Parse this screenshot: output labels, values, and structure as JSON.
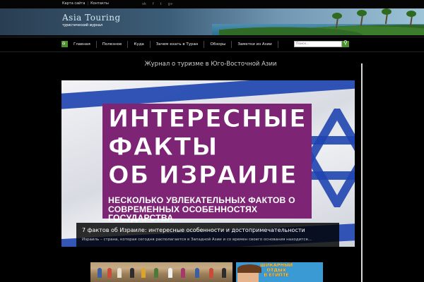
{
  "topbar": {
    "links": [
      "Карта сайта",
      "Контакты"
    ],
    "social": [
      "vk-icon",
      "facebook-icon",
      "twitter-icon",
      "google-plus-icon"
    ]
  },
  "header": {
    "logo_title": "Asia Touring",
    "logo_subtitle": "туристический журнал"
  },
  "nav": {
    "items": [
      "Главная",
      "Полезное",
      "Куда",
      "Зачем ехать в Туран",
      "Обзоры",
      "Заметки из Азии"
    ],
    "search_placeholder": "Поиск..."
  },
  "main": {
    "page_title": "Журнал о туризме в Юго-Восточной Азии"
  },
  "featured": {
    "image_lines": [
      "ИНТЕРЕСНЫЕ",
      "ФАКТЫ",
      "ОБ ИЗРАИЛЕ"
    ],
    "image_sub_lines": [
      "НЕСКОЛЬКО УВЛЕКАТЕЛЬНЫХ ФАКТОВ О",
      "СОВРЕМЕННЫХ ОСОБЕННОСТЯХ ГОСУДАРСТВА"
    ],
    "title": "7 фактов об Израиле: интересные особенности и достопримечательности",
    "excerpt": "Израиль – страна, которая сегодня располагается в Западной Азии и со времен своего основания находится..."
  },
  "thumbs": {
    "second_text_lines": [
      "ШИКАРНЫЙ",
      "ОТДЫХ",
      "В ЕГИПТЕ"
    ]
  },
  "colors": {
    "accent_green": "#4d8f2e",
    "purple": "#7d2475",
    "flag_blue": "#1f45b0"
  }
}
